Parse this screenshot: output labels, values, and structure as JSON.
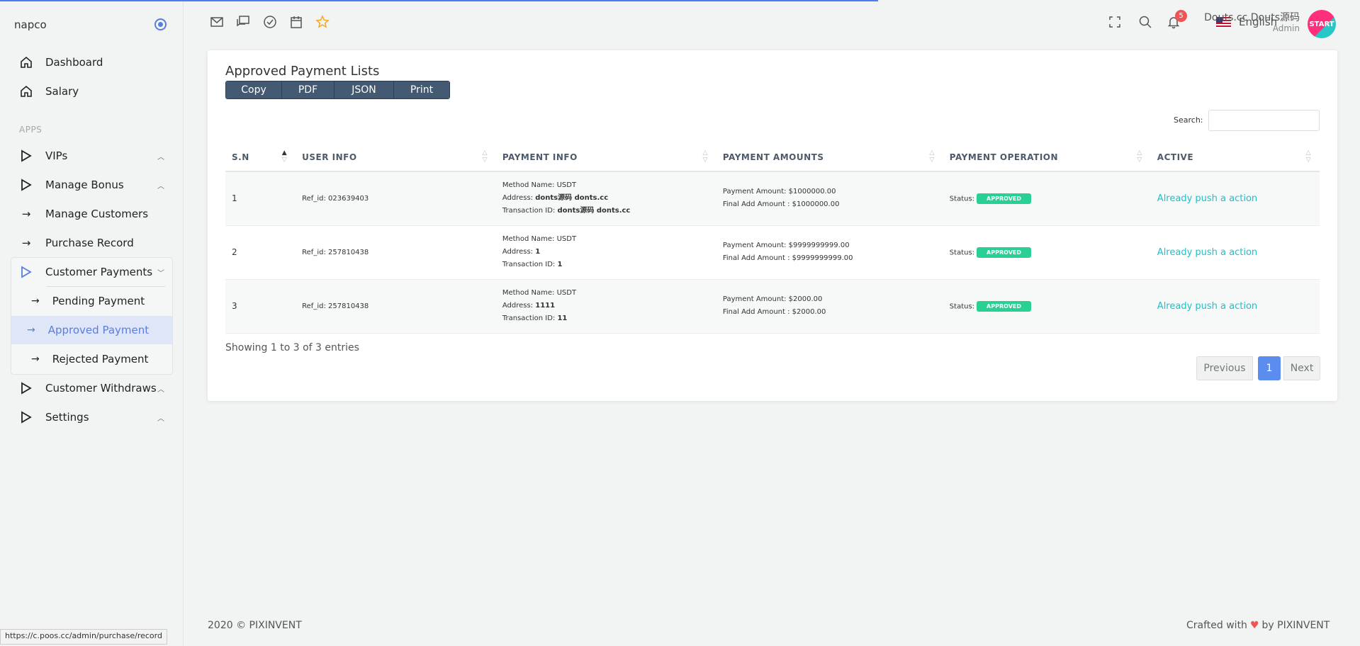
{
  "brand": "napco",
  "sidebar": {
    "section_label": "APPS",
    "items": [
      {
        "label": "Dashboard"
      },
      {
        "label": "Salary"
      },
      {
        "label": "VIPs"
      },
      {
        "label": "Manage Bonus"
      },
      {
        "label": "Manage Customers"
      },
      {
        "label": "Purchase Record"
      },
      {
        "label": "Customer Payments"
      },
      {
        "label": "Customer Withdraws"
      },
      {
        "label": "Settings"
      }
    ],
    "submenu": [
      {
        "label": "Pending Payment"
      },
      {
        "label": "Approved Payment"
      },
      {
        "label": "Rejected Payment"
      }
    ]
  },
  "topbar": {
    "language": "English",
    "notification_count": "5",
    "user_name": "Dонts.cc Dонts源码",
    "user_role": "Admin",
    "avatar_text": "START"
  },
  "card": {
    "title": "Approved Payment Lists",
    "buttons": [
      "Copy",
      "PDF",
      "JSON",
      "Print"
    ],
    "search_label": "Search:",
    "columns": [
      "S.N",
      "USER INFO",
      "PAYMENT INFO",
      "PAYMENT AMOUNTS",
      "PAYMENT OPERATION",
      "ACTIVE"
    ],
    "rows": [
      {
        "sn": "1",
        "user": "Ref_id: 023639403",
        "method": "Method Name: USDT",
        "address_label": "Address: ",
        "address": "donts源码 donts.cc",
        "txn_label": "Transaction ID: ",
        "txn": "donts源码 donts.cc",
        "amount": "Payment Amount: $1000000.00",
        "final": "Final Add Amount : $1000000.00",
        "status_label": "Status:",
        "status": "APPROVED",
        "action": "Already push a action"
      },
      {
        "sn": "2",
        "user": "Ref_id: 257810438",
        "method": "Method Name: USDT",
        "address_label": "Address: ",
        "address": "1",
        "txn_label": "Transaction ID: ",
        "txn": "1",
        "amount": "Payment Amount: $9999999999.00",
        "final": "Final Add Amount : $9999999999.00",
        "status_label": "Status:",
        "status": "APPROVED",
        "action": "Already push a action"
      },
      {
        "sn": "3",
        "user": "Ref_id: 257810438",
        "method": "Method Name: USDT",
        "address_label": "Address: ",
        "address": "1111",
        "txn_label": "Transaction ID: ",
        "txn": "11",
        "amount": "Payment Amount: $2000.00",
        "final": "Final Add Amount : $2000.00",
        "status_label": "Status:",
        "status": "APPROVED",
        "action": "Already push a action"
      }
    ],
    "showing": "Showing 1 to 3 of 3 entries",
    "pager": {
      "prev": "Previous",
      "page": "1",
      "next": "Next"
    }
  },
  "footer": {
    "left": "2020 © PIXINVENT",
    "right_prefix": "Crafted with",
    "right_suffix": "by PIXINVENT"
  },
  "status_url": "https://c.poos.cc/admin/purchase/record",
  "colors": {
    "accent": "#5a7de0",
    "approved": "#28d094",
    "link": "#1ec1c9",
    "badge": "#f05454"
  }
}
